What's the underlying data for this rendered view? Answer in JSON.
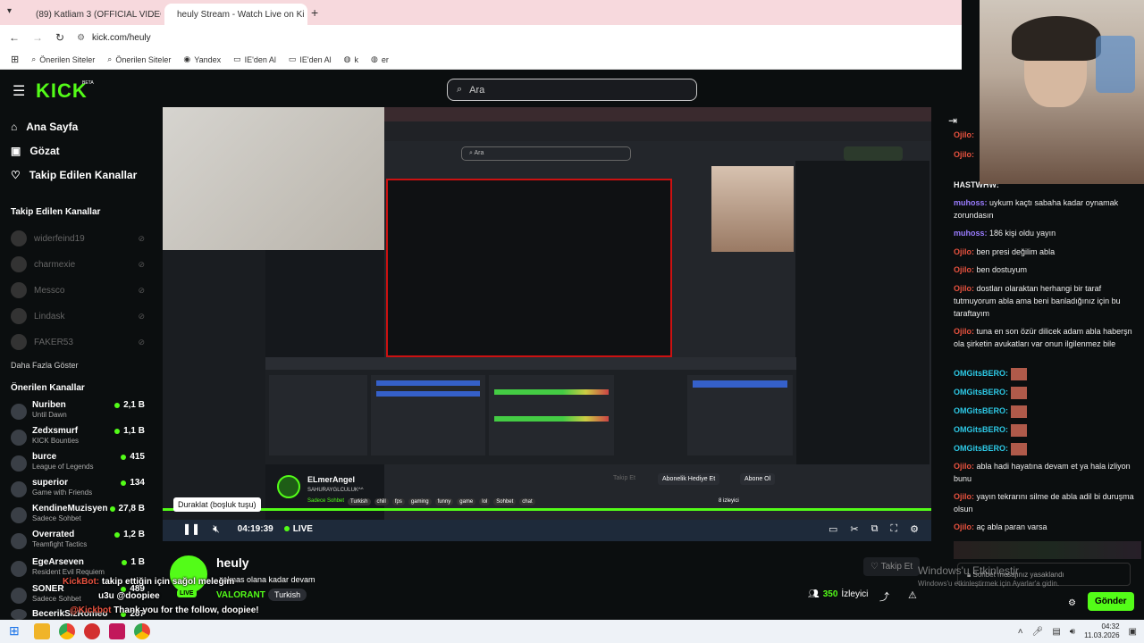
{
  "browser": {
    "tabs": [
      {
        "title": "(89) Katliam 3 (OFFICIAL VIDEO",
        "icon": "youtube-icon",
        "color": "#ff0000"
      },
      {
        "title": "heuly Stream - Watch Live on Ki",
        "icon": "kick-icon",
        "color": "#53fc18"
      }
    ],
    "url": "kick.com/heuly",
    "bookmarks": [
      "Önerilen Siteler",
      "Önerilen Siteler",
      "Yandex",
      "IE'den Al",
      "IE'den Al",
      "k",
      "er"
    ]
  },
  "kick": {
    "logo": "KICK",
    "beta": "BETA",
    "search_placeholder": "Ara",
    "accent": "#53fc18"
  },
  "sidebar": {
    "nav": [
      {
        "label": "Ana Sayfa",
        "icon": "home-icon"
      },
      {
        "label": "Gözat",
        "icon": "browse-icon"
      },
      {
        "label": "Takip Edilen Kanallar",
        "icon": "heart-icon"
      }
    ],
    "followed_title": "Takip Edilen Kanallar",
    "followed": [
      "widerfeind19",
      "charmexie",
      "Messco",
      "Lindask",
      "FAKER53"
    ],
    "more_label": "Daha Fazla Göster",
    "recommended_title": "Önerilen Kanallar",
    "recommended": [
      {
        "name": "Nuriben",
        "category": "Until Dawn",
        "viewers": "2,1 B"
      },
      {
        "name": "Zedxsmurf",
        "category": "KICK Bounties",
        "viewers": "1,1 B"
      },
      {
        "name": "burce",
        "category": "League of Legends",
        "viewers": "415"
      },
      {
        "name": "superior",
        "category": "Game with Friends",
        "viewers": "134"
      },
      {
        "name": "KendineMuzisyen",
        "category": "Sadece Sohbet",
        "viewers": "27,8 B"
      },
      {
        "name": "Overrated",
        "category": "Teamfight Tactics",
        "viewers": "1,2 B"
      },
      {
        "name": "EgeArseven",
        "category": "Resident Evil Requiem",
        "viewers": "1 B"
      },
      {
        "name": "SONER",
        "category": "Sadece Sohbet",
        "viewers": "489"
      },
      {
        "name": "BecerikSizRomeo",
        "category": "",
        "viewers": "287"
      }
    ]
  },
  "player": {
    "tooltip": "Duraklat (boşluk tuşu)",
    "time": "04:19:39",
    "live_label": "LIVE",
    "inner_streamer": "ELmerAngel",
    "inner_title": "SAHURAYGLCULUK^^",
    "inner_tags": [
      "Sadece Sohbet",
      "Turkish",
      "chill",
      "fps",
      "gaming",
      "funny",
      "game",
      "lol",
      "Sohbet",
      "chat"
    ],
    "inner_gift": "Abonelik Hediye Et",
    "inner_sub": "Abone Ol",
    "inner_follow": "Takip Et",
    "inner_viewers": "8 izleyici"
  },
  "stream": {
    "streamer": "heuly",
    "live_badge": "LIVE",
    "title": "...almas olana kadar devam",
    "category": "VALORANT",
    "language": "Turkish",
    "viewers": "350",
    "viewers_label": "İzleyici",
    "follow_label": "Takip Et"
  },
  "overlay_chat": [
    {
      "user": "KickBot:",
      "text": "takip ettiğin için sağol meleğim"
    },
    {
      "user": "",
      "text": "u3u @doopiee"
    },
    {
      "user": "@Kickbot",
      "text": "Thank you for the follow, doopiee!"
    }
  ],
  "chat": {
    "messages": [
      {
        "user": "Ojilo:",
        "text": "",
        "y": 0
      },
      {
        "user": "Ojilo:",
        "text": "",
        "y": 0
      },
      {
        "user": "HASTWHW:",
        "text": "",
        "y": 0
      },
      {
        "user": "muhoss:",
        "text": "uykum kaçtı sabaha kadar oynamak zorundasın"
      },
      {
        "user": "muhoss:",
        "text": "186 kişi oldu yayın"
      },
      {
        "user": "Ojilo:",
        "text": "ben presi değilim abla"
      },
      {
        "user": "Ojilo:",
        "text": "ben dostuyum"
      },
      {
        "user": "Ojilo:",
        "text": "dostları olaraktan herhangi bir taraf tutmuyorum abla ama beni banladığınız için bu taraftayım"
      },
      {
        "user": "Ojilo:",
        "text": "tuna en son özür dilicek adam abla haberşn ola şirketin avukatları var onun ilgilenmez bile"
      },
      {
        "user": "OMGitsBERO:",
        "text": ""
      },
      {
        "user": "OMGitsBERO:",
        "text": ""
      },
      {
        "user": "OMGitsBERO:",
        "text": ""
      },
      {
        "user": "OMGitsBERO:",
        "text": ""
      },
      {
        "user": "OMGitsBERO:",
        "text": ""
      },
      {
        "user": "Ojilo:",
        "text": "abla hadi hayatına devam et ya hala izliyon bunu"
      },
      {
        "user": "Ojilo:",
        "text": "yayın tekrarını silme de abla adil bi duruşma olsun"
      },
      {
        "user": "Ojilo:",
        "text": "aç abla paran varsa"
      }
    ],
    "input_placeholder": "Sohbet mesajınız yasaklandı",
    "send_label": "Gönder",
    "user_color": "#e8523f",
    "bero_color": "#2dc9e6"
  },
  "windows": {
    "activate_title": "Windows'u Etkinleştir",
    "activate_sub": "Windows'u etkinleştirmek için Ayarlar'a gidin.",
    "time": "04:32",
    "date": "11.03.2026"
  }
}
